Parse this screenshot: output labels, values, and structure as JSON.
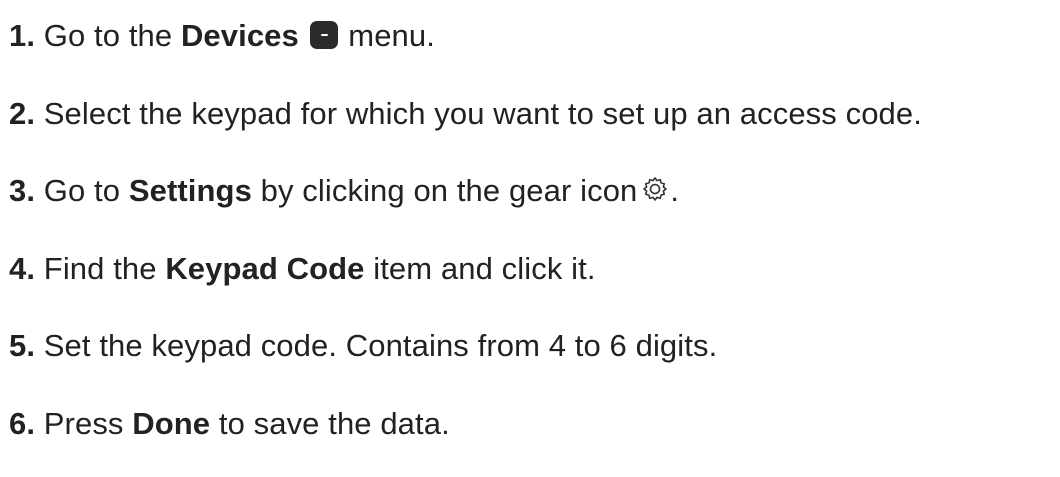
{
  "steps": [
    {
      "number": "1.",
      "text_a": "Go to the",
      "bold_a": "Devices",
      "icon": "devices-menu-icon",
      "text_b": "menu."
    },
    {
      "number": "2.",
      "text_a": "Select the keypad for which you want to set up an access code."
    },
    {
      "number": "3.",
      "text_a": "Go to",
      "bold_a": "Settings",
      "text_b": "by clicking on the gear icon",
      "icon": "gear-icon",
      "text_c": "."
    },
    {
      "number": "4.",
      "text_a": "Find the",
      "bold_a": "Keypad Code",
      "text_b": "item and click it."
    },
    {
      "number": "5.",
      "text_a": "Set the keypad code. Contains from 4 to 6 digits."
    },
    {
      "number": "6.",
      "text_a": "Press",
      "bold_a": "Done",
      "text_b": "to save the data."
    }
  ],
  "colors": {
    "text": "#222222",
    "icon_fill": "#2b2b2b",
    "background": "#ffffff"
  }
}
